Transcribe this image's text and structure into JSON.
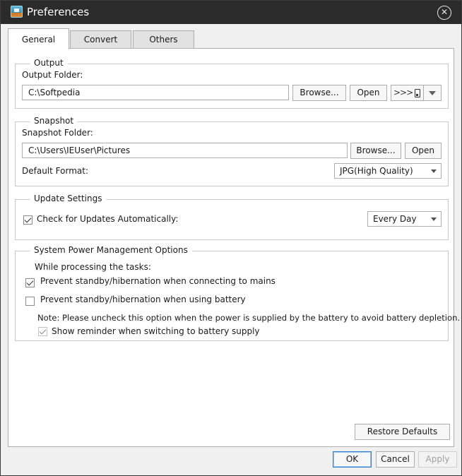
{
  "window": {
    "title": "Preferences"
  },
  "tabs": [
    {
      "label": "General",
      "active": true
    },
    {
      "label": "Convert",
      "active": false
    },
    {
      "label": "Others",
      "active": false
    }
  ],
  "output": {
    "legend": "Output",
    "folder_label": "Output Folder:",
    "folder_value": "C:\\Softpedia",
    "browse_label": "Browse...",
    "open_label": "Open",
    "device_button": ">>>"
  },
  "snapshot": {
    "legend": "Snapshot",
    "folder_label": "Snapshot Folder:",
    "folder_value": "C:\\Users\\IEUser\\Pictures",
    "browse_label": "Browse...",
    "open_label": "Open",
    "format_label": "Default Format:",
    "format_value": "JPG(High Quality)"
  },
  "update": {
    "legend": "Update Settings",
    "check_label": "Check for Updates Automatically:",
    "check_checked": true,
    "frequency_value": "Every Day"
  },
  "power": {
    "legend": "System Power Management Options",
    "intro": "While processing the tasks:",
    "mains_label": "Prevent standby/hibernation when connecting to mains",
    "mains_checked": true,
    "battery_label": "Prevent standby/hibernation when using battery",
    "battery_checked": false,
    "note": "Note: Please uncheck this option when the power is supplied by the battery to avoid battery depletion.",
    "reminder_label": "Show reminder when switching to battery supply",
    "reminder_checked": true
  },
  "panel": {
    "restore_label": "Restore Defaults"
  },
  "footer": {
    "ok_label": "OK",
    "cancel_label": "Cancel",
    "apply_label": "Apply"
  },
  "icons": {
    "app": "app-logo-icon",
    "close": "close-circle-icon",
    "device": "media-player-icon",
    "dropdown": "chevron-down-icon"
  },
  "colors": {
    "titlebar": "#2b2b2b",
    "accent_border": "#2a7fd4"
  }
}
